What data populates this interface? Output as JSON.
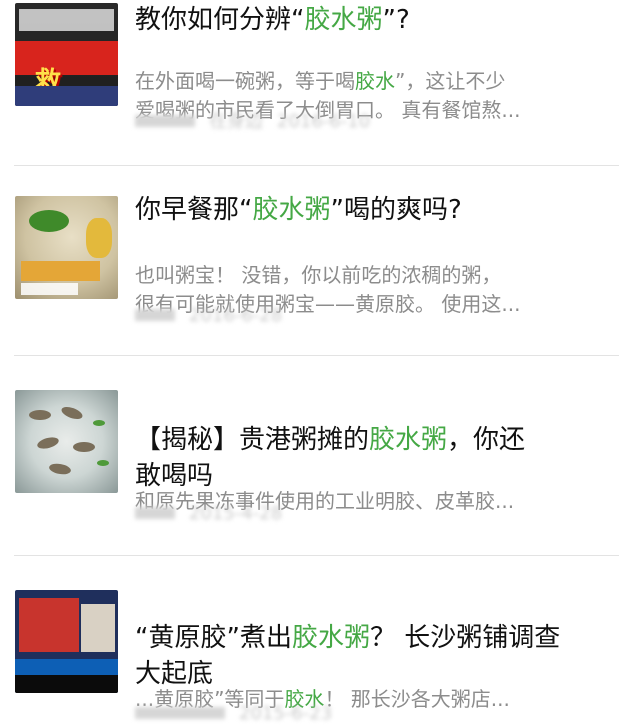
{
  "items": [
    {
      "title_parts": [
        "教你如何分辨“",
        "胶水粥",
        "”?"
      ],
      "title_hl": [
        false,
        true,
        false
      ],
      "desc_parts": [
        "在外面喝一碗粥，等于喝",
        "胶水",
        "”，这让不少\n爱喝粥的市民看了大倒胃口。 真有餐馆熬..."
      ],
      "desc_hl": [
        false,
        true,
        false
      ],
      "meta": [
        "",
        "在身边",
        "2016-6-10"
      ],
      "thumb_icon": "news-thumbnail-red-banner"
    },
    {
      "title_parts": [
        "你早餐那“",
        "胶水粥",
        "”喝的爽吗?"
      ],
      "title_hl": [
        false,
        true,
        false
      ],
      "desc_parts": [
        "也叫粥宝！ 没错，你以前吃的浓稠的粥，\n很有可能就使用粥宝——黄原胶。 使用这..."
      ],
      "desc_hl": [
        false
      ],
      "meta": [
        "",
        "2016-6-28"
      ],
      "thumb_icon": "porridge-bowl-thumbnail"
    },
    {
      "title_parts": [
        "【揭秘】贵港粥摊的",
        "胶水粥",
        "，你还\n敢喝吗"
      ],
      "title_hl": [
        false,
        true,
        false
      ],
      "desc_parts": [
        "和原先果冻事件使用的工业明胶、皮革胶..."
      ],
      "desc_hl": [
        false
      ],
      "meta": [
        "",
        "2015-4-28"
      ],
      "thumb_icon": "shrimp-porridge-thumbnail"
    },
    {
      "title_parts": [
        "“黄原胶”煮出",
        "胶水粥",
        "？ 长沙粥铺调查\n大起底"
      ],
      "title_hl": [
        false,
        true,
        false
      ],
      "desc_parts": [
        "...黄原胶”等同于",
        "胶水",
        "！ 那长沙各大粥店..."
      ],
      "desc_hl": [
        false,
        true,
        false
      ],
      "meta": [
        "",
        "2015-6-23"
      ],
      "thumb_icon": "tv-news-thumbnail"
    }
  ],
  "colors": {
    "highlight": "#45a845",
    "title": "#111111",
    "desc": "#8c8c8c",
    "meta": "#c9c9c9",
    "divider": "#e3e3e3"
  }
}
